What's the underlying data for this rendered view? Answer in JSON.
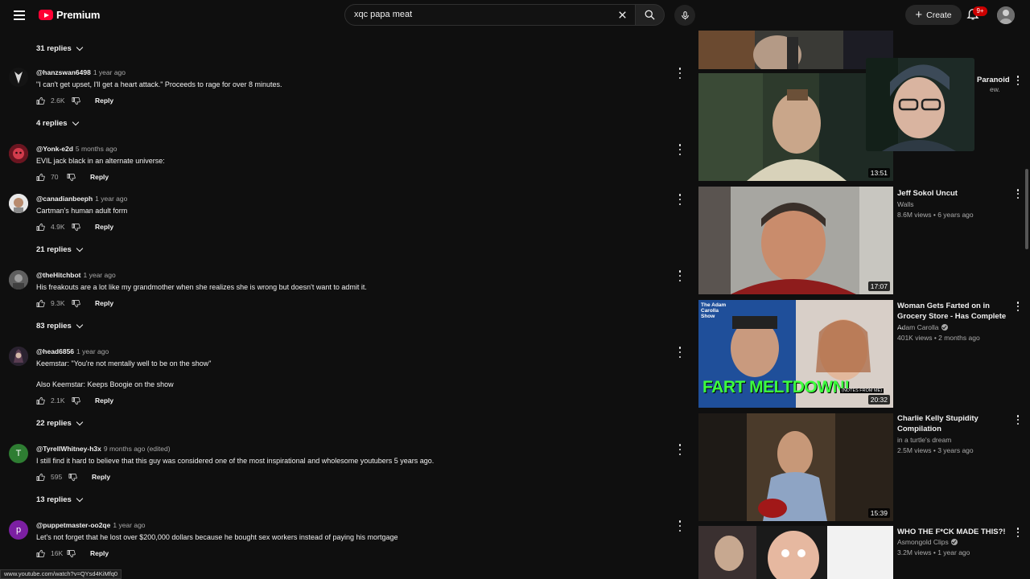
{
  "header": {
    "brand": "Premium",
    "search_value": "xqc papa meat",
    "create_label": "Create",
    "notification_badge": "9+"
  },
  "comments": [
    {
      "replies_label": "31 replies"
    },
    {
      "username": "@hanzswan6498",
      "time": "1 year ago",
      "text": "\"I can't get upset, I'll get a heart attack.\"  Proceeds to rage for over 8 minutes.",
      "likes": "2.6K",
      "reply_label": "Reply",
      "replies_label": "4 replies",
      "avatar_color": "#1a1a1a"
    },
    {
      "username": "@Yonk-e2d",
      "time": "5 months ago",
      "text": "EVIL jack black in an alternate universe:",
      "likes": "70",
      "reply_label": "Reply",
      "avatar_color": "#b3283a"
    },
    {
      "username": "@canadianbeeph",
      "time": "1 year ago",
      "text": "Cartman's human adult form",
      "likes": "4.9K",
      "reply_label": "Reply",
      "replies_label": "21 replies",
      "avatar_color": "#d9d9d9"
    },
    {
      "username": "@theHitchbot",
      "time": "1 year ago",
      "text": "His freakouts are a lot like my grandmother when she realizes she is wrong but doesn't want to admit it.",
      "likes": "9.3K",
      "reply_label": "Reply",
      "replies_label": "83 replies",
      "avatar_color": "#6f6f6f"
    },
    {
      "username": "@head6856",
      "time": "1 year ago",
      "text": "Keemstar: \"You're not mentally well to be on the show\"",
      "text2": "Also Keemstar: Keeps Boogie on the show",
      "likes": "2.1K",
      "reply_label": "Reply",
      "replies_label": "22 replies",
      "avatar_color": "#3b2f3a"
    },
    {
      "username": "@TyrellWhitney-h3x",
      "time": "9 months ago (edited)",
      "text": "I still find it hard to believe that this guy was considered one of the most inspirational and wholesome youtubers 5 years ago.",
      "likes": "595",
      "reply_label": "Reply",
      "replies_label": "13 replies",
      "avatar_letter": "T",
      "avatar_color": "#2e7d32"
    },
    {
      "username": "@puppetmaster-oo2qe",
      "time": "1 year ago",
      "text": "Let's not forget that he lost over $200,000 dollars because he bought sex workers instead of paying his mortgage",
      "likes": "16K",
      "reply_label": "Reply",
      "avatar_letter": "p",
      "avatar_color": "#7b1fa2"
    }
  ],
  "status_bar_url": "www.youtube.com/watch?v=QYsd4KiMfq0",
  "videos": [
    {
      "title": "Paranoid",
      "title_tail": "ew.",
      "duration": "13:51"
    },
    {
      "title": "Jeff Sokol Uncut",
      "channel": "Walls",
      "meta": "8.6M views • 6 years ago",
      "duration": "17:07"
    },
    {
      "title": "Woman Gets Farted on in Grocery Store - Has Complete ...",
      "channel": "Adam Carolla",
      "verified": true,
      "meta": "401K views • 2 months ago",
      "duration": "20:32",
      "thumb_caption": "FART MELTDOWN!",
      "thumb_caption2": "(NOTES FROM ME)",
      "thumb_brand": "The Adam Carolla Show"
    },
    {
      "title": "Charlie Kelly Stupidity Compilation",
      "channel": "in a turtle's dream",
      "meta": "2.5M views • 3 years ago",
      "duration": "15:39"
    },
    {
      "title": "WHO THE F*CK MADE THIS?!",
      "channel": "Asmongold Clips",
      "verified": true,
      "meta": "3.2M views • 1 year ago"
    }
  ],
  "colors": {
    "background": "#0f0f0f",
    "text": "#f1f1f1",
    "secondary": "#aaaaaa",
    "brand_red": "#ff0033"
  }
}
